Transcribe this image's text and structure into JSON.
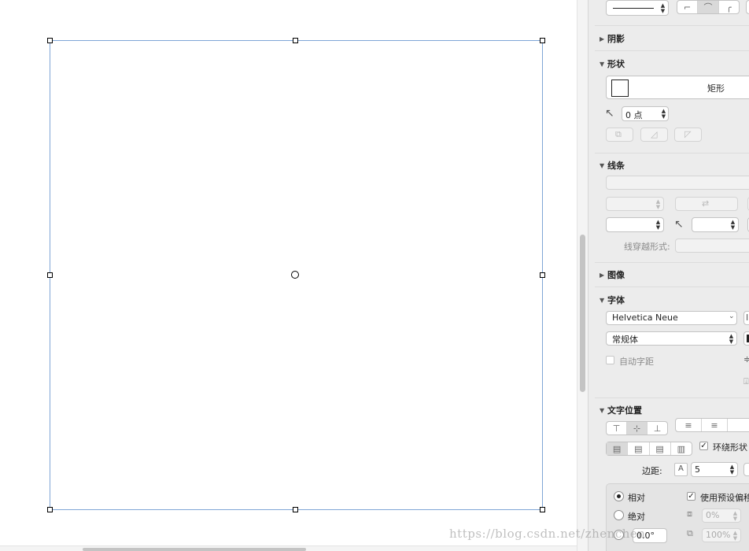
{
  "canvas": {
    "shape_name": "rectangle-shape"
  },
  "inspector": {
    "shadow": {
      "header": "阴影",
      "expanded": false
    },
    "shape": {
      "header": "形状",
      "expanded": true,
      "shape_type": "矩形",
      "corner_radius": "0 点"
    },
    "stroke": {
      "header": "线条",
      "expanded": true,
      "cross_label": "线穿越形式:"
    },
    "image": {
      "header": "图像",
      "expanded": false
    },
    "font": {
      "header": "字体",
      "expanded": true,
      "family": "Helvetica Neue",
      "style": "常规体",
      "auto_kerning_label": "自动字距",
      "auto_kerning_checked": false
    },
    "text_position": {
      "header": "文字位置",
      "expanded": true,
      "wrap_label": "环绕形状",
      "wrap_checked": true,
      "margin_label": "边距:",
      "margin_value": "5",
      "relative_label": "相对",
      "absolute_label": "绝对",
      "use_preset_label": "使用预设偏移",
      "use_preset_checked": true,
      "offset_x": "0%",
      "offset_scale": "100%",
      "rotation": "0.0°",
      "selected_mode": "relative"
    }
  },
  "watermark": "https://blog.csdn.net/zhenchen"
}
